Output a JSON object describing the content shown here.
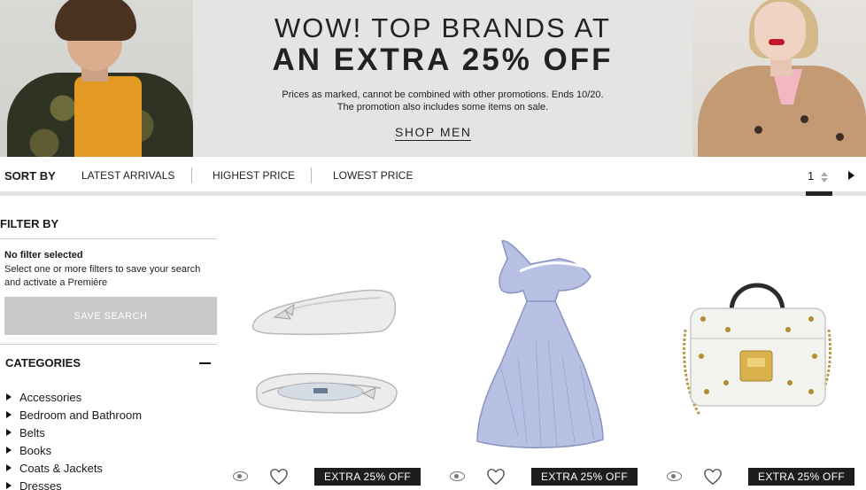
{
  "banner": {
    "headline_line1": "WOW! TOP BRANDS AT",
    "headline_line2": "AN EXTRA 25% OFF",
    "fine_print_line1": "Prices as marked, cannot be combined with other promotions. Ends 10/20.",
    "fine_print_line2": "The promotion also includes some items on sale.",
    "cta_label": "SHOP MEN"
  },
  "sort": {
    "label": "SORT BY",
    "options": [
      "LATEST ARRIVALS",
      "HIGHEST PRICE",
      "LOWEST PRICE"
    ]
  },
  "pagination": {
    "current_page": "1",
    "next_icon": "chevron-right-icon"
  },
  "filter": {
    "title": "FILTER BY",
    "status": "No filter selected",
    "help": "Select one or more filters to save your search and activate a Première",
    "save_button": "SAVE SEARCH",
    "categories_title": "CATEGORIES",
    "categories": [
      "Accessories",
      "Bedroom and Bathroom",
      "Belts",
      "Books",
      "Coats & Jackets",
      "Dresses"
    ]
  },
  "products": [
    {
      "badge": "EXTRA 25% OFF",
      "image": "silver ballet flats"
    },
    {
      "badge": "EXTRA 25% OFF",
      "image": "striped ruffle dress"
    },
    {
      "badge": "EXTRA 25% OFF",
      "image": "white studded handbag"
    }
  ],
  "colors": {
    "badge_bg": "#1d1d1d",
    "button_disabled": "#c8c8c8",
    "banner_bg": "#e4e5e2"
  }
}
